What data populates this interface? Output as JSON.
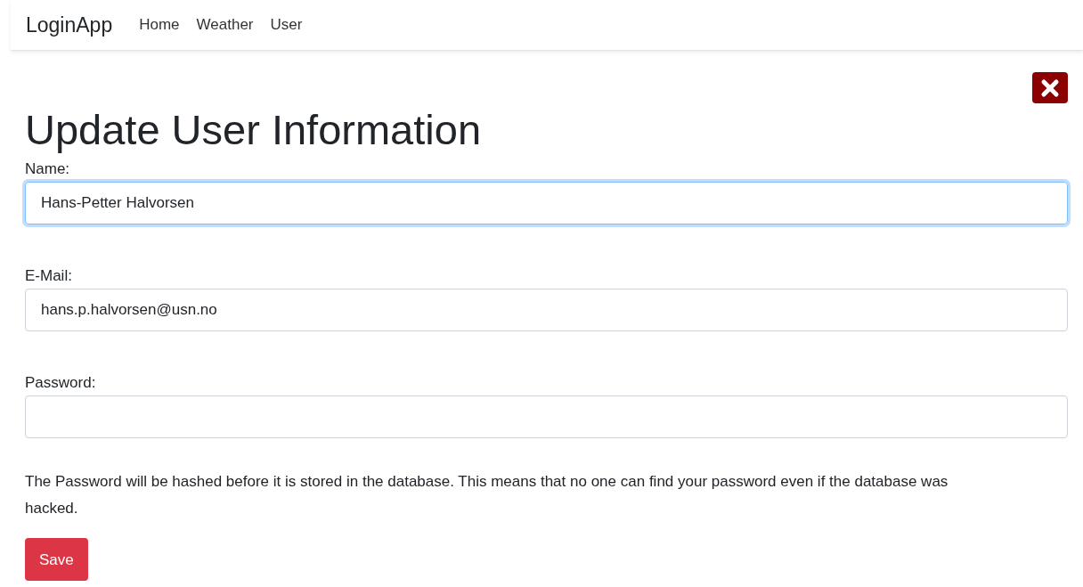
{
  "navbar": {
    "brand": "LoginApp",
    "links": [
      {
        "label": "Home"
      },
      {
        "label": "Weather"
      },
      {
        "label": "User"
      }
    ]
  },
  "heading": "Update User Information",
  "fields": [
    {
      "label": "Name:",
      "value": "Hans-Petter Halvorsen",
      "focused": true
    },
    {
      "label": "E-Mail:",
      "value": "hans.p.halvorsen@usn.no",
      "focused": false
    },
    {
      "label": "Password:",
      "focused": false
    }
  ],
  "note": "The Password will be hashed before it is stored in the database. This means that no one can find your password even if the database was hacked.",
  "save_button": "Save"
}
